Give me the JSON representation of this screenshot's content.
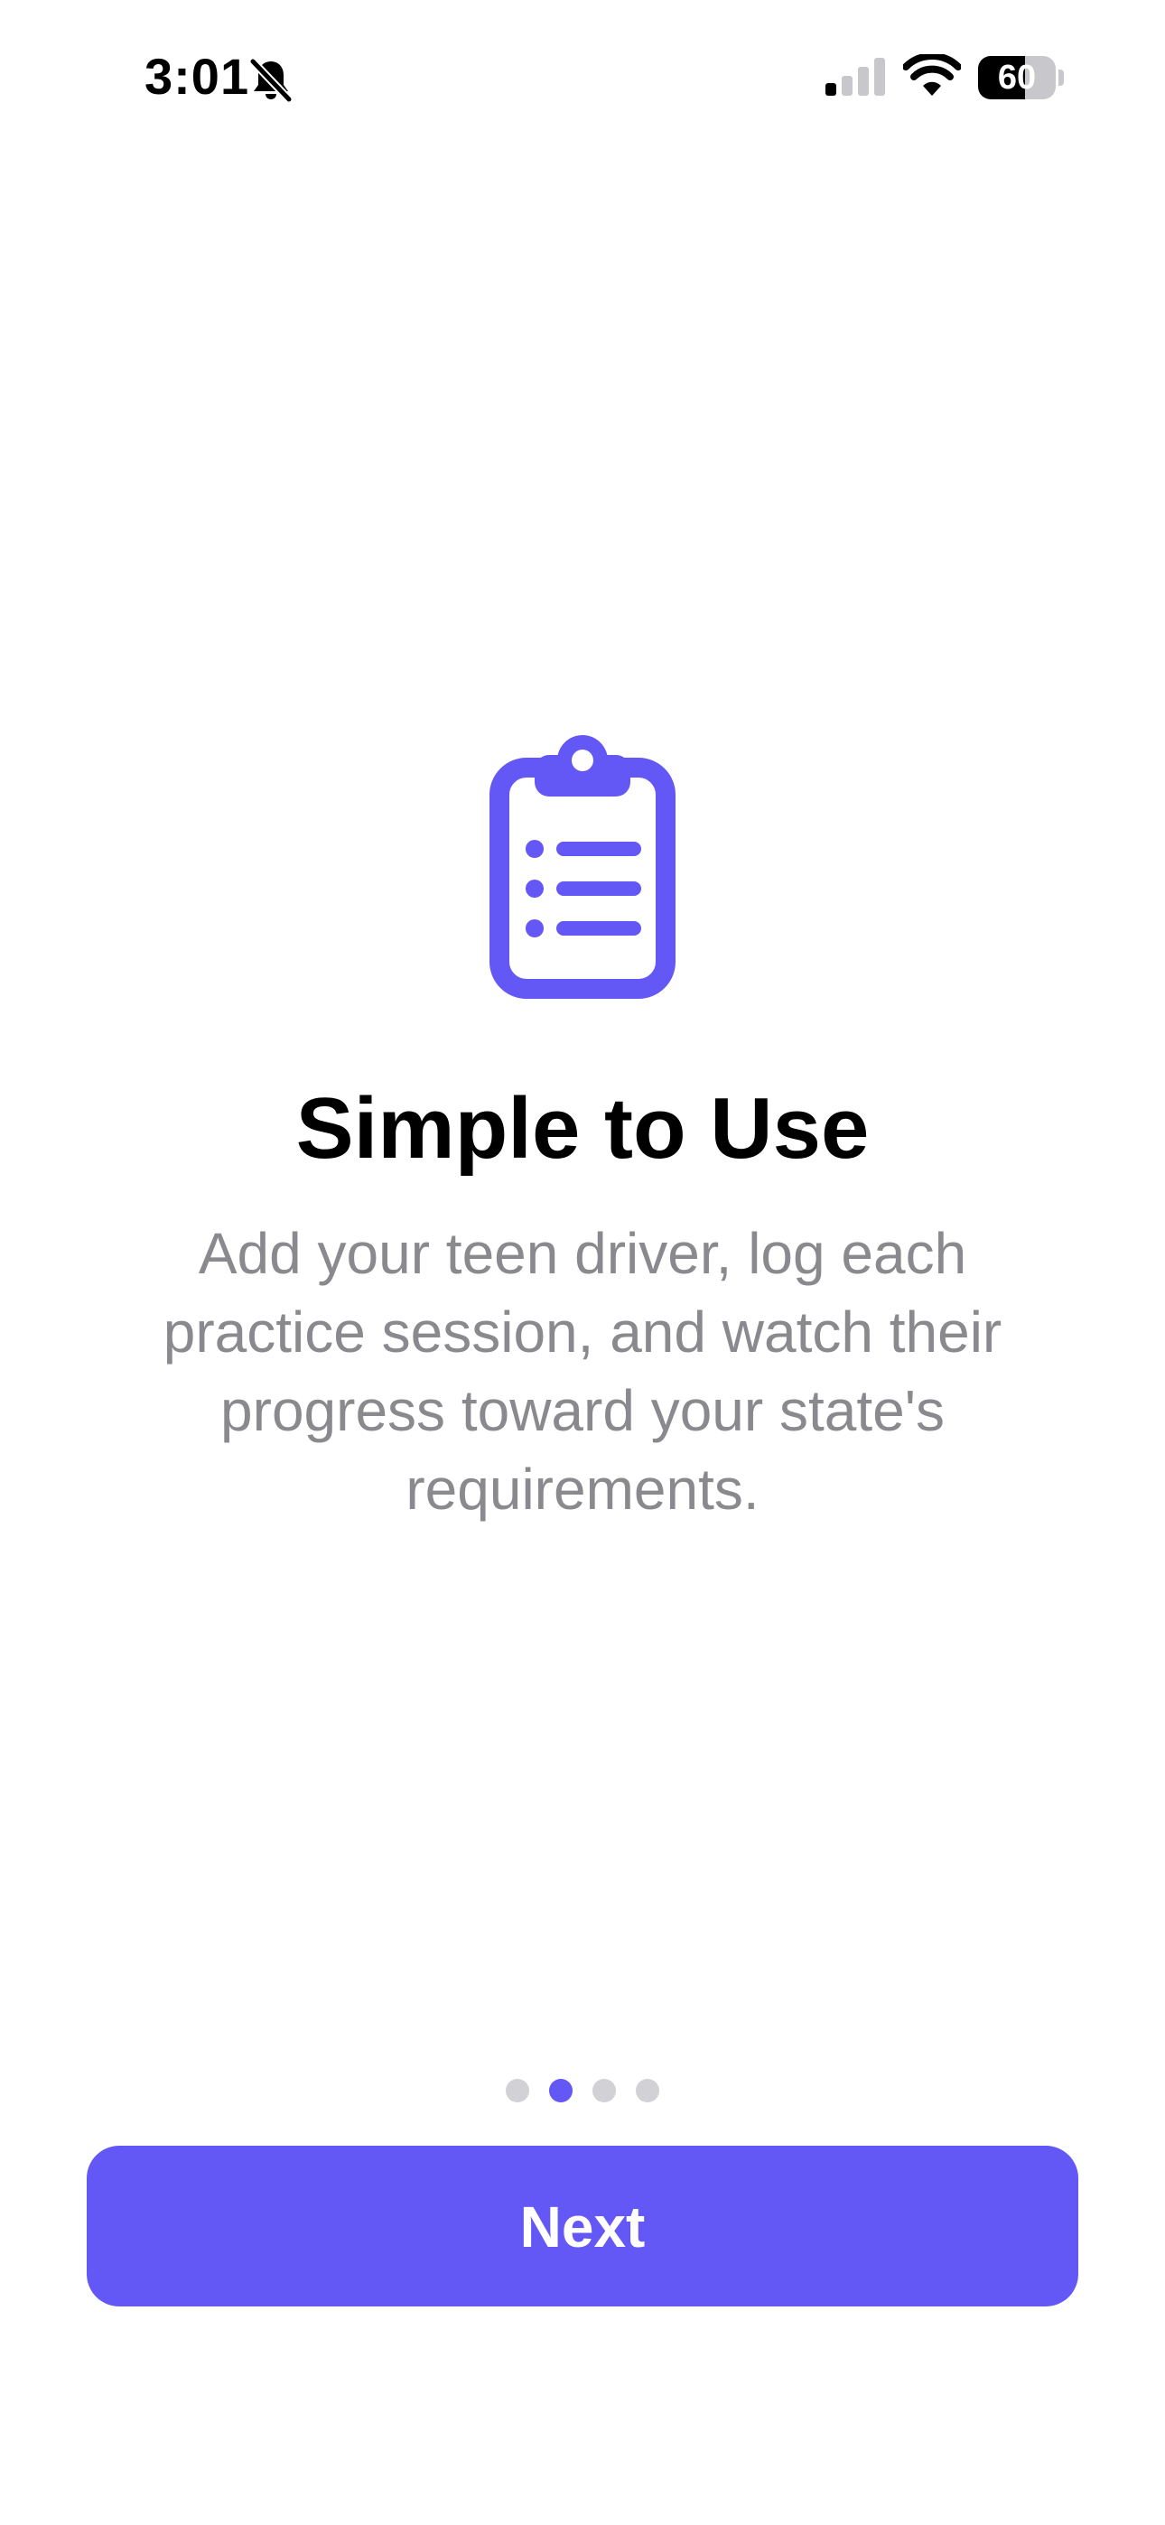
{
  "status_bar": {
    "time": "3:01",
    "silent_icon": "bell-slash-icon",
    "signal_icon": "cellular-signal-icon",
    "signal_bars_active": 1,
    "signal_bars_total": 4,
    "wifi_icon": "wifi-icon",
    "battery_icon": "battery-icon",
    "battery_level": "60",
    "battery_fraction": 0.6
  },
  "onboarding": {
    "icon": "clipboard-list-icon",
    "title": "Simple to Use",
    "description": "Add your teen driver, log each practice session, and watch their progress toward your state's requirements.",
    "page_count": 4,
    "current_page": 2
  },
  "actions": {
    "next_label": "Next"
  },
  "colors": {
    "accent": "#6357F5",
    "title_text": "#000000",
    "body_text": "#8A8A8E",
    "dot_inactive": "#D1D1D6",
    "background": "#FFFFFF"
  }
}
